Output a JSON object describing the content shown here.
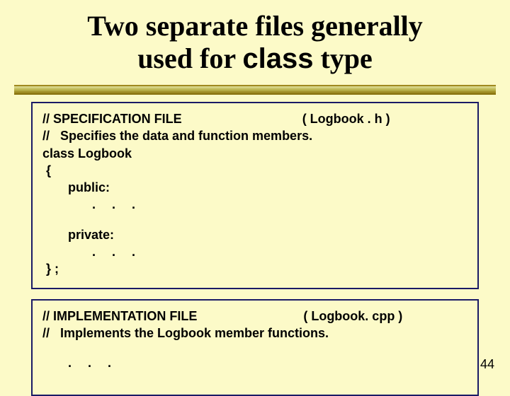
{
  "title_line1": "Two separate files generally",
  "title_line2_a": "used for ",
  "title_line2_b": "class",
  "title_line2_c": " type",
  "box1": {
    "spec_label": "//   SPECIFICATION FILE",
    "spec_file": "( Logbook . h )",
    "spec_desc": "//   Specifies the data and function members.",
    "class_decl": "class Logbook",
    "brace_open": " {",
    "public_kw": "public:",
    "dots1": ".   .   .",
    "private_kw": "private:",
    "dots2": ".   .   .",
    "brace_close": " } ;"
  },
  "box2": {
    "impl_label": "//   IMPLEMENTATION FILE",
    "impl_file": "( Logbook. cpp )",
    "impl_desc": "//   Implements the Logbook member functions.",
    "dots": ".   .   ."
  },
  "page_number": "44"
}
